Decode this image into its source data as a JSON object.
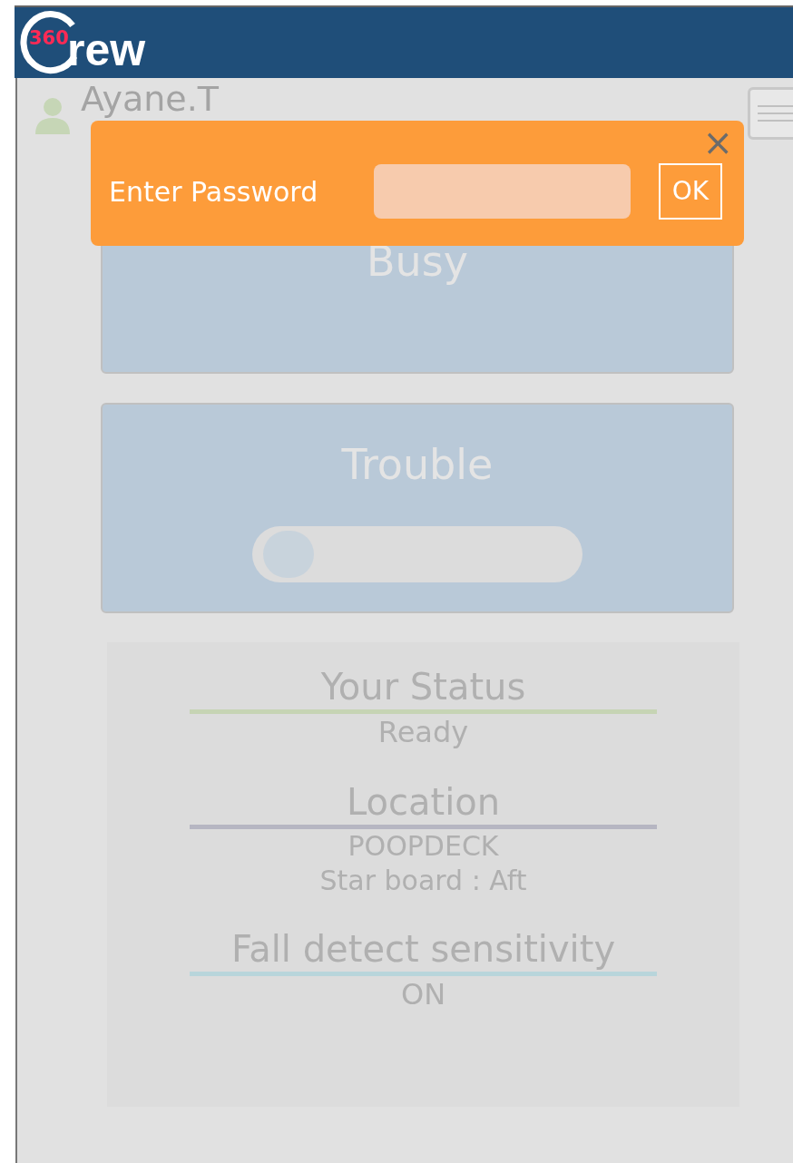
{
  "logo": {
    "number": "360",
    "word": "rew"
  },
  "user": {
    "name": "Ayane.T"
  },
  "cards": [
    {
      "title": "Busy",
      "kind": "plain"
    },
    {
      "title": "Trouble",
      "kind": "toggle",
      "on": false
    }
  ],
  "status": [
    {
      "label": "Your Status",
      "color": "#c6d4b4",
      "values": [
        "Ready"
      ]
    },
    {
      "label": "Location",
      "color": "#b6b6c2",
      "values": [
        "POOPDECK",
        "Star board : Aft"
      ]
    },
    {
      "label": "Fall detect sensitivity",
      "color": "#b8d5db",
      "values": [
        "ON"
      ]
    }
  ],
  "dialog": {
    "label": "Enter Password",
    "close": "×",
    "button": "OK"
  }
}
